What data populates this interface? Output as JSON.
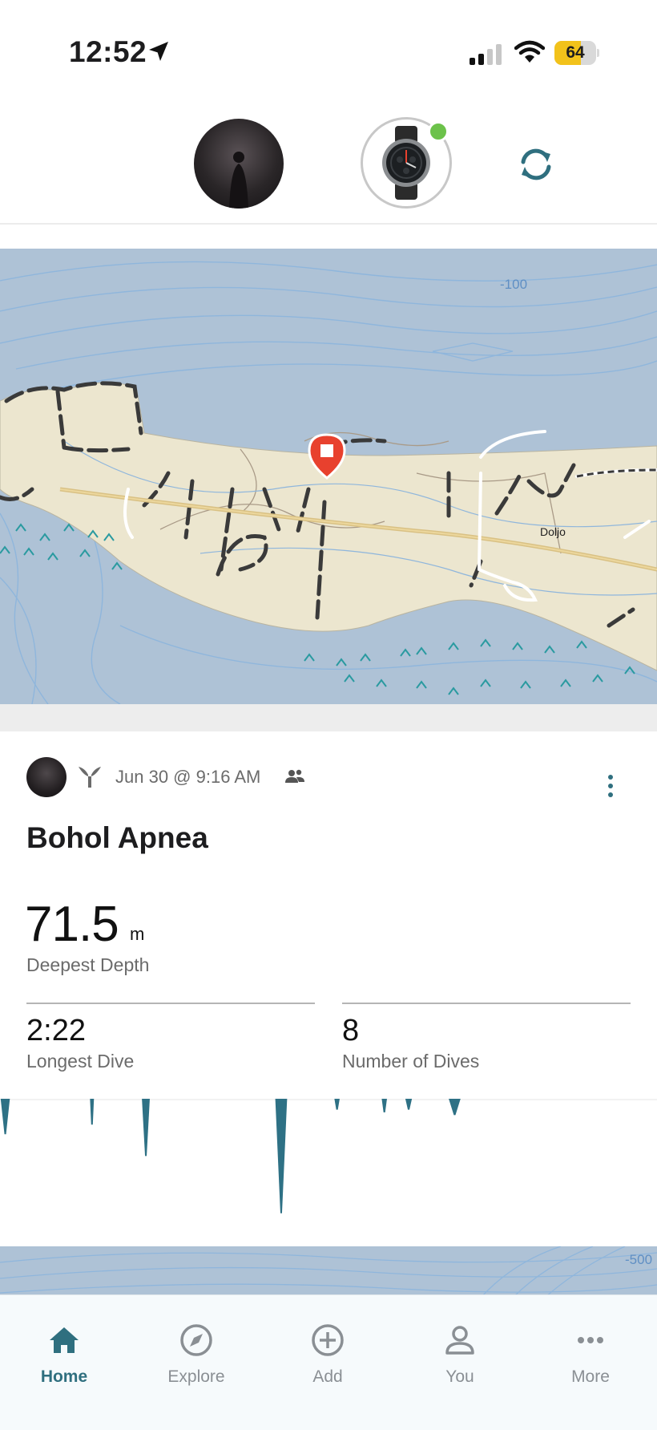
{
  "status_bar": {
    "time": "12:52",
    "battery": "64",
    "battery_level": 0.64,
    "icons": [
      "location-arrow-icon",
      "cellular-signal-icon",
      "wifi-icon",
      "battery-icon"
    ]
  },
  "header": {
    "device_connected": true,
    "icons": [
      "profile-avatar",
      "watch-device-icon",
      "sync-icon"
    ]
  },
  "map": {
    "contour_label_top": "-100",
    "place_label": "Doljo",
    "marker": "activity-start-marker",
    "contour_label_bottom": "-500"
  },
  "activity": {
    "date": "Jun 30 @ 9:16 AM",
    "title": "Bohol Apnea",
    "deepest_depth": {
      "value": "71.5",
      "unit": "m",
      "label": "Deepest Depth"
    },
    "longest_dive": {
      "value": "2:22",
      "label": "Longest Dive"
    },
    "number_of_dives": {
      "value": "8",
      "label": "Number of Dives"
    },
    "icons": [
      "whale-tail-icon",
      "group-icon",
      "more-options-icon"
    ]
  },
  "dive_profile": {
    "color": "#2e7185",
    "dives": [
      {
        "position": 0.008,
        "depth": 0.26,
        "width": 0.014
      },
      {
        "position": 0.14,
        "depth": 0.19,
        "width": 0.006
      },
      {
        "position": 0.222,
        "depth": 0.42,
        "width": 0.012
      },
      {
        "position": 0.428,
        "depth": 0.84,
        "width": 0.018
      },
      {
        "position": 0.513,
        "depth": 0.08,
        "width": 0.008
      },
      {
        "position": 0.585,
        "depth": 0.1,
        "width": 0.008
      },
      {
        "position": 0.622,
        "depth": 0.08,
        "width": 0.01
      },
      {
        "position": 0.692,
        "depth": 0.12,
        "width": 0.018
      }
    ]
  },
  "tabs": [
    {
      "label": "Home",
      "icon": "home-icon",
      "active": true
    },
    {
      "label": "Explore",
      "icon": "compass-icon",
      "active": false
    },
    {
      "label": "Add",
      "icon": "add-icon",
      "active": false
    },
    {
      "label": "You",
      "icon": "user-icon",
      "active": false
    },
    {
      "label": "More",
      "icon": "more-icon",
      "active": false
    }
  ],
  "colors": {
    "accent": "#2f6f7f",
    "water": "#aec2d6",
    "land": "#ece6cf",
    "marker": "#e8412e",
    "online": "#6cc24a"
  }
}
